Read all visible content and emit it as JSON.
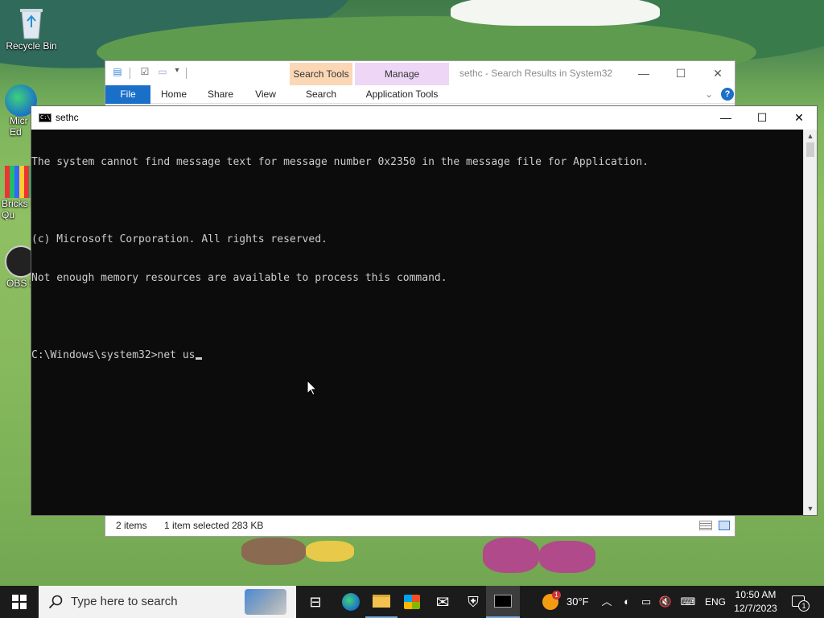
{
  "desktop": {
    "icons": [
      {
        "label": "Recycle Bin"
      },
      {
        "label": "Micr\nEd"
      },
      {
        "label": "Bricks I\nQu"
      },
      {
        "label": "OBS S"
      }
    ]
  },
  "explorer": {
    "title": "sethc - Search Results in System32",
    "context_tabs": {
      "search_tools": "Search Tools",
      "manage": "Manage"
    },
    "ribbon_tabs": [
      "File",
      "Home",
      "Share",
      "View",
      "Search",
      "Application Tools"
    ],
    "status": {
      "items": "2 items",
      "selected": "1 item selected",
      "size": "283 KB"
    },
    "colors": {
      "search_tools": "#fcd7b6",
      "manage": "#eed6f7",
      "file_tab": "#1a6fc9"
    }
  },
  "cmd": {
    "title": "sethc",
    "lines": [
      "The system cannot find message text for message number 0x2350 in the message file for Application.",
      "",
      "(c) Microsoft Corporation. All rights reserved.",
      "Not enough memory resources are available to process this command.",
      "",
      "C:\\Windows\\system32>net us"
    ]
  },
  "taskbar": {
    "search_placeholder": "Type here to search",
    "weather": "30°F",
    "weather_badge": "1",
    "language": "ENG",
    "time": "10:50 AM",
    "date": "12/7/2023",
    "notification_count": "1"
  }
}
